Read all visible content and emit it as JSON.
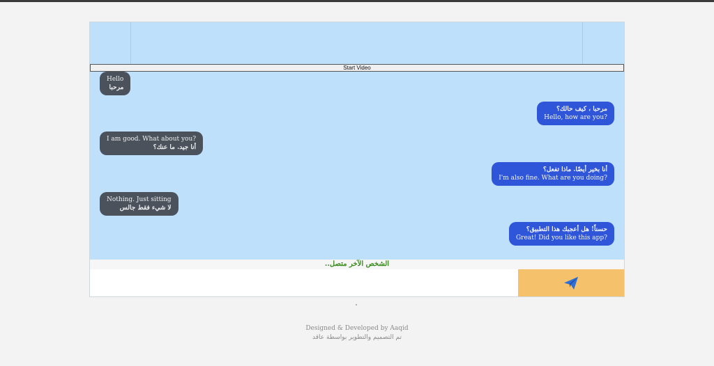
{
  "controls": {
    "start_video_label": "Start Video"
  },
  "messages": [
    {
      "side": "recv",
      "en": "Hello",
      "ar": "مرحبا"
    },
    {
      "side": "sent",
      "ar": "مرحبا ، كيف حالك؟",
      "en": "Hello, how are you?"
    },
    {
      "side": "recv",
      "en": "I am good. What about you?",
      "ar": "أنا جيد. ما عنك؟"
    },
    {
      "side": "sent",
      "ar": "أنا بخير أيضًا. ماذا تفعل؟",
      "en": "I'm also fine. What are you doing?"
    },
    {
      "side": "recv",
      "en": "Nothing. Just sitting",
      "ar": "لا شيء فقط جالس"
    },
    {
      "side": "sent",
      "ar": "حسناً! هل أعجبك هذا التطبيق؟",
      "en": "Great! Did you like this app?"
    }
  ],
  "status": {
    "text": "الشخص الآخر متصل.."
  },
  "composer": {
    "value": "",
    "placeholder": ""
  },
  "footer": {
    "credit_en": "Designed & Developed by Aaqid",
    "credit_ar": "تم التصميم والتطوير بواسطة عاقد"
  },
  "colors": {
    "chat_background": "#bfe0fb",
    "received_bubble": "#4c525c",
    "sent_bubble": "#2f55d9",
    "send_button": "#f5c26b",
    "status_text": "#3a8a1e"
  },
  "icons": {
    "send": "paper-plane-icon"
  }
}
